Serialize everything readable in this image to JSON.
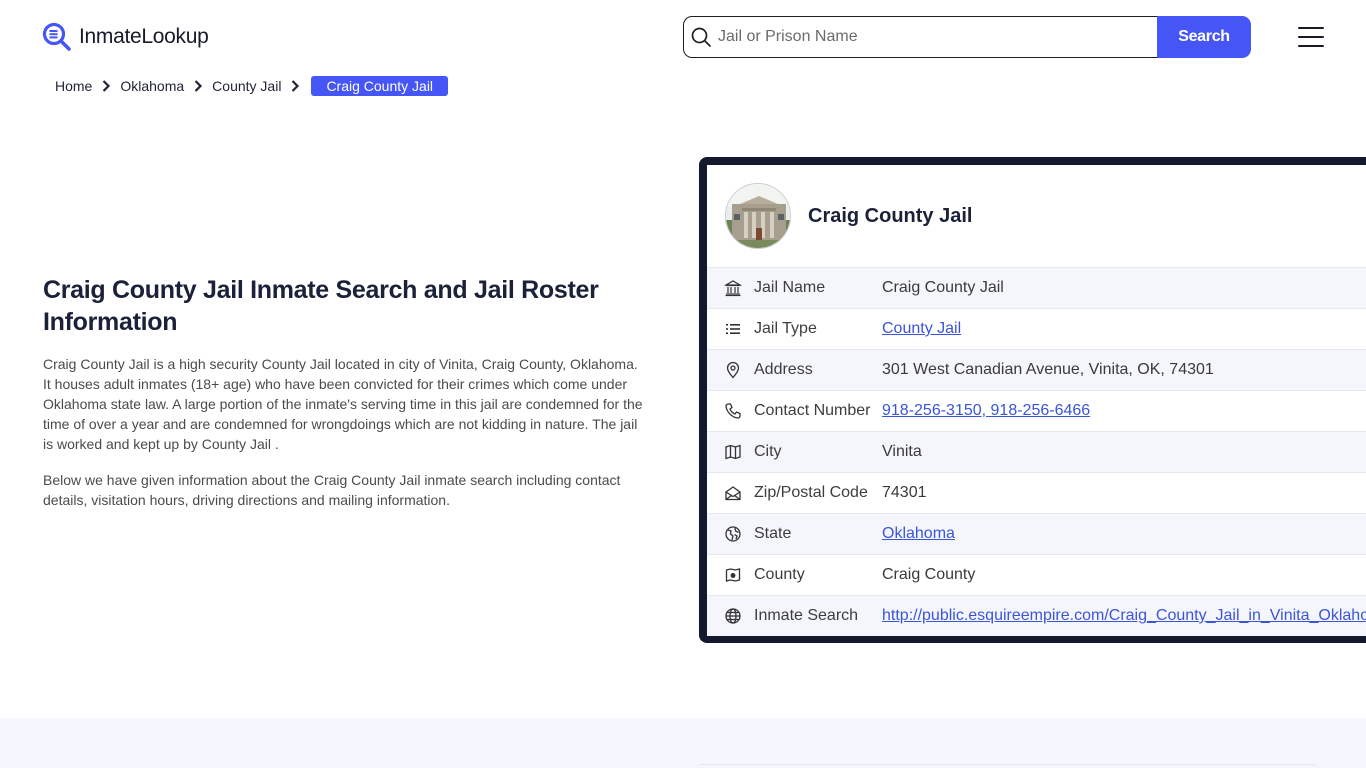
{
  "header": {
    "logo_text": "InmateLookup",
    "search_placeholder": "Jail or Prison Name",
    "search_value": "",
    "search_button": "Search"
  },
  "breadcrumb": {
    "items": [
      "Home",
      "Oklahoma",
      "County Jail"
    ],
    "current": "Craig County Jail"
  },
  "intro": {
    "title": "Craig County Jail Inmate Search and Jail Roster Information",
    "paragraphs": [
      "Craig County Jail is a high security County Jail located in city of Vinita, Craig County, Oklahoma. It houses adult inmates (18+ age) who have been convicted for their crimes which come under Oklahoma state law. A large portion of the inmate's serving time in this jail are condemned for the time of over a year and are condemned for wrongdoings which are not kidding in nature. The jail is worked and kept up by County Jail .",
      "Below we have given information about the Craig County Jail inmate search including contact details, visitation hours, driving directions and mailing information."
    ]
  },
  "card": {
    "title": "Craig County Jail",
    "rows": [
      {
        "icon": "building-columns-icon",
        "label": "Jail Name",
        "value": "Craig County Jail",
        "link": false
      },
      {
        "icon": "list-icon",
        "label": "Jail Type",
        "value": "County Jail",
        "link": true
      },
      {
        "icon": "map-pin-icon",
        "label": "Address",
        "value": "301 West Canadian Avenue, Vinita, OK, 74301",
        "link": false
      },
      {
        "icon": "phone-icon",
        "label": "Contact Number",
        "value": "918-256-3150, 918-256-6466",
        "link": true
      },
      {
        "icon": "map-icon",
        "label": "City",
        "value": "Vinita",
        "link": false
      },
      {
        "icon": "envelope-open-icon",
        "label": "Zip/Postal Code",
        "value": "74301",
        "link": false
      },
      {
        "icon": "globe-region-icon",
        "label": "State",
        "value": "Oklahoma",
        "link": true
      },
      {
        "icon": "map-marker-square-icon",
        "label": "County",
        "value": "Craig County",
        "link": false
      },
      {
        "icon": "globe-icon",
        "label": "Inmate Search",
        "value": "http://public.esquireempire.com/Craig_County_Jail_in_Vinita_Oklahoma",
        "link": true
      }
    ]
  },
  "colors": {
    "accent": "#4655f5",
    "card_border": "#131a2d",
    "link": "#3b55d9",
    "row_alt": "#f5f6fc"
  }
}
